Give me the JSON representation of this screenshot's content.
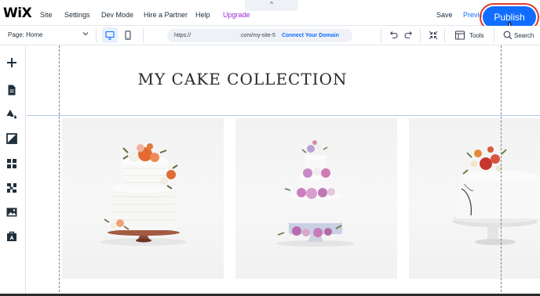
{
  "topbar": {
    "logo": "WiX",
    "menu": [
      "Site",
      "Settings",
      "Dev Mode",
      "Hire a Partner",
      "Help",
      "Upgrade"
    ],
    "collapse_glyph": "^",
    "save_label": "Save",
    "preview_label": "Preview",
    "publish_label": "Publish"
  },
  "bar2": {
    "page_label": "Page: Home",
    "url_prefix": "https://",
    "url_path": ".com/my-site-5",
    "connect_label": "Connect Your Domain",
    "tools_label": "Tools",
    "search_label": "Search"
  },
  "canvas": {
    "title": "MY CAKE COLLECTION"
  },
  "left_toolbar": [
    "add-icon",
    "pages-icon",
    "design-icon",
    "add-section-icon",
    "apps-icon",
    "business-icon",
    "media-icon",
    "portfolio-icon"
  ],
  "colors": {
    "accent": "#116dff",
    "upgrade": "#9a27d5",
    "highlight_ring": "#e0392b"
  }
}
